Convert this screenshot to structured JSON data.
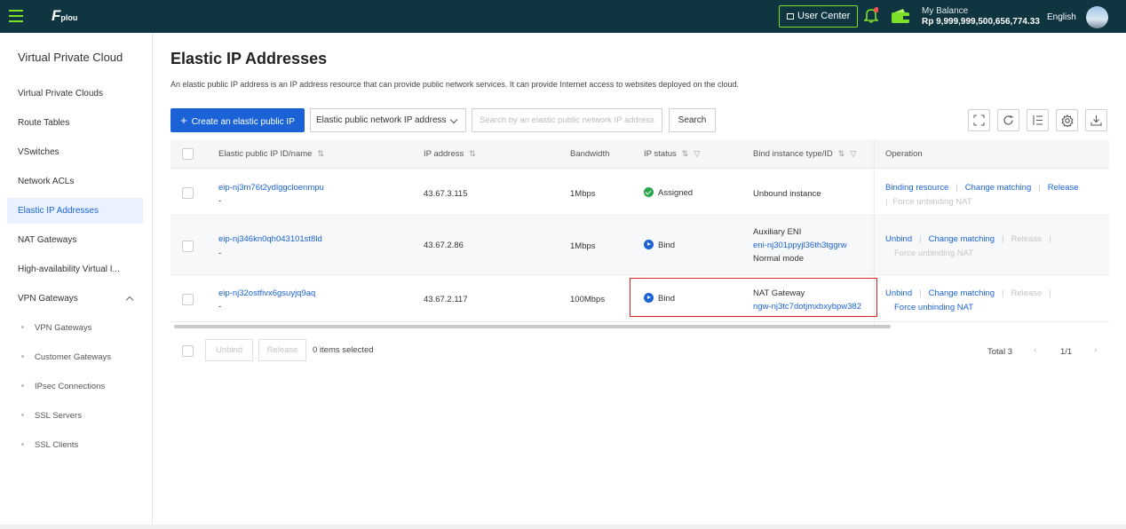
{
  "header": {
    "logo_text": "plou",
    "user_center": "User Center",
    "balance_label": "My Balance",
    "balance_value": "Rp 9,999,999,500,656,774.33",
    "language": "English",
    "colors": {
      "topbar": "#0f3540",
      "accent": "#7fe02a",
      "primary": "#1a62d6",
      "highlight": "#e02020"
    }
  },
  "sidebar": {
    "title": "Virtual Private Cloud",
    "items": [
      {
        "label": "Virtual Private Clouds"
      },
      {
        "label": "Route Tables"
      },
      {
        "label": "VSwitches"
      },
      {
        "label": "Network ACLs"
      },
      {
        "label": "Elastic IP Addresses",
        "active": true
      },
      {
        "label": "NAT Gateways"
      },
      {
        "label": "High-availability Virtual I..."
      },
      {
        "label": "VPN Gateways",
        "expanded": true
      }
    ],
    "sub_items": [
      {
        "label": "VPN Gateways"
      },
      {
        "label": "Customer Gateways"
      },
      {
        "label": "IPsec Connections"
      },
      {
        "label": "SSL Servers"
      },
      {
        "label": "SSL Clients"
      }
    ]
  },
  "main": {
    "title": "Elastic IP Addresses",
    "description": "An elastic public IP address is an IP address resource that can provide public network services. It can provide Internet access to websites deployed on the cloud.",
    "create_button": "Create an elastic public IP",
    "filter_select": "Elastic public network IP address",
    "search_placeholder": "Search by an elastic public network IP address",
    "search_button": "Search",
    "toolbar_icons": [
      "fullscreen-icon",
      "refresh-icon",
      "column-settings-icon",
      "gear-icon",
      "download-icon"
    ]
  },
  "table": {
    "columns": {
      "id": "Elastic public IP ID/name",
      "ip": "IP address",
      "bandwidth": "Bandwidth",
      "status": "IP status",
      "bind": "Bind instance type/ID",
      "operation": "Operation"
    },
    "rows": [
      {
        "id": "eip-nj3m76t2ydlggcloenmpu",
        "name": "-",
        "ip": "43.67.3.115",
        "bandwidth": "1Mbps",
        "status": "Assigned",
        "bind_type": "Unbound instance",
        "bind_id": "",
        "bind_mode": "",
        "ops": [
          "Binding resource",
          "Change matching",
          "Release",
          "Force unbinding NAT"
        ]
      },
      {
        "id": "eip-nj346kn0qh043101st8ld",
        "name": "-",
        "ip": "43.67.2.86",
        "bandwidth": "1Mbps",
        "status": "Bind",
        "bind_type": "Auxiliary ENI",
        "bind_id": "eni-nj301ppyjl36th3tggrw",
        "bind_mode": "Normal mode",
        "ops": [
          "Unbind",
          "Change matching",
          "Release",
          "Force unbinding NAT"
        ]
      },
      {
        "id": "eip-nj32ostfivx6gsuyjq9aq",
        "name": "-",
        "ip": "43.67.2.117",
        "bandwidth": "100Mbps",
        "status": "Bind",
        "bind_type": "NAT Gateway",
        "bind_id": "ngw-nj3tc7dotjmxbxybpw382",
        "bind_mode": "",
        "ops": [
          "Unbind",
          "Change matching",
          "Release",
          "Force unbinding NAT"
        ]
      }
    ]
  },
  "footer": {
    "unbind": "Unbind",
    "release": "Release",
    "selected": "0 items selected",
    "total": "Total 3",
    "page": "1/1"
  }
}
